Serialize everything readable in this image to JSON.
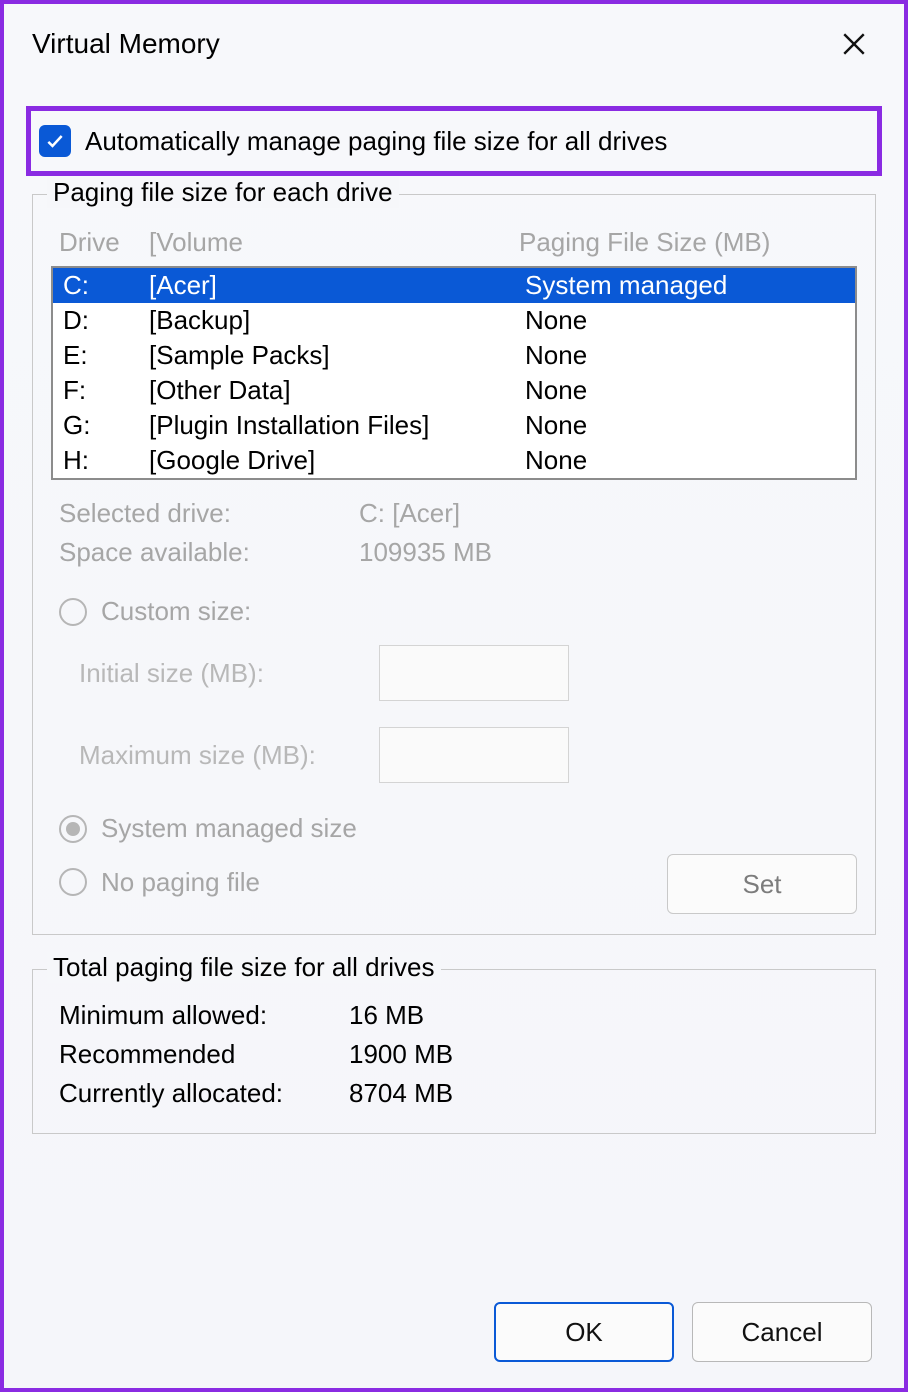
{
  "window": {
    "title": "Virtual Memory"
  },
  "auto_manage": {
    "checked": true,
    "label": "Automatically manage paging file size for all drives"
  },
  "per_drive": {
    "legend": "Paging file size for each drive",
    "header_drive": "Drive",
    "header_volume": "[Volume",
    "header_size": "Paging File Size (MB)",
    "rows": [
      {
        "drive": "C:",
        "volume": "[Acer]",
        "size": "System managed",
        "selected": true
      },
      {
        "drive": "D:",
        "volume": "[Backup]",
        "size": "None"
      },
      {
        "drive": "E:",
        "volume": "[Sample Packs]",
        "size": "None"
      },
      {
        "drive": "F:",
        "volume": "[Other Data]",
        "size": "None"
      },
      {
        "drive": "G:",
        "volume": "[Plugin Installation Files]",
        "size": "None"
      },
      {
        "drive": "H:",
        "volume": "[Google Drive]",
        "size": "None"
      }
    ],
    "selected_label": "Selected drive:",
    "selected_value": "C:  [Acer]",
    "space_label": "Space available:",
    "space_value": "109935 MB",
    "radio_custom": "Custom size:",
    "initial_label": "Initial size (MB):",
    "initial_value": "",
    "maximum_label": "Maximum size (MB):",
    "maximum_value": "",
    "radio_system": "System managed size",
    "radio_none": "No paging file",
    "set_button": "Set"
  },
  "totals": {
    "legend": "Total paging file size for all drives",
    "min_label": "Minimum allowed:",
    "min_value": "16 MB",
    "rec_label": "Recommended",
    "rec_value": "1900 MB",
    "cur_label": "Currently allocated:",
    "cur_value": "8704 MB"
  },
  "footer": {
    "ok": "OK",
    "cancel": "Cancel"
  }
}
